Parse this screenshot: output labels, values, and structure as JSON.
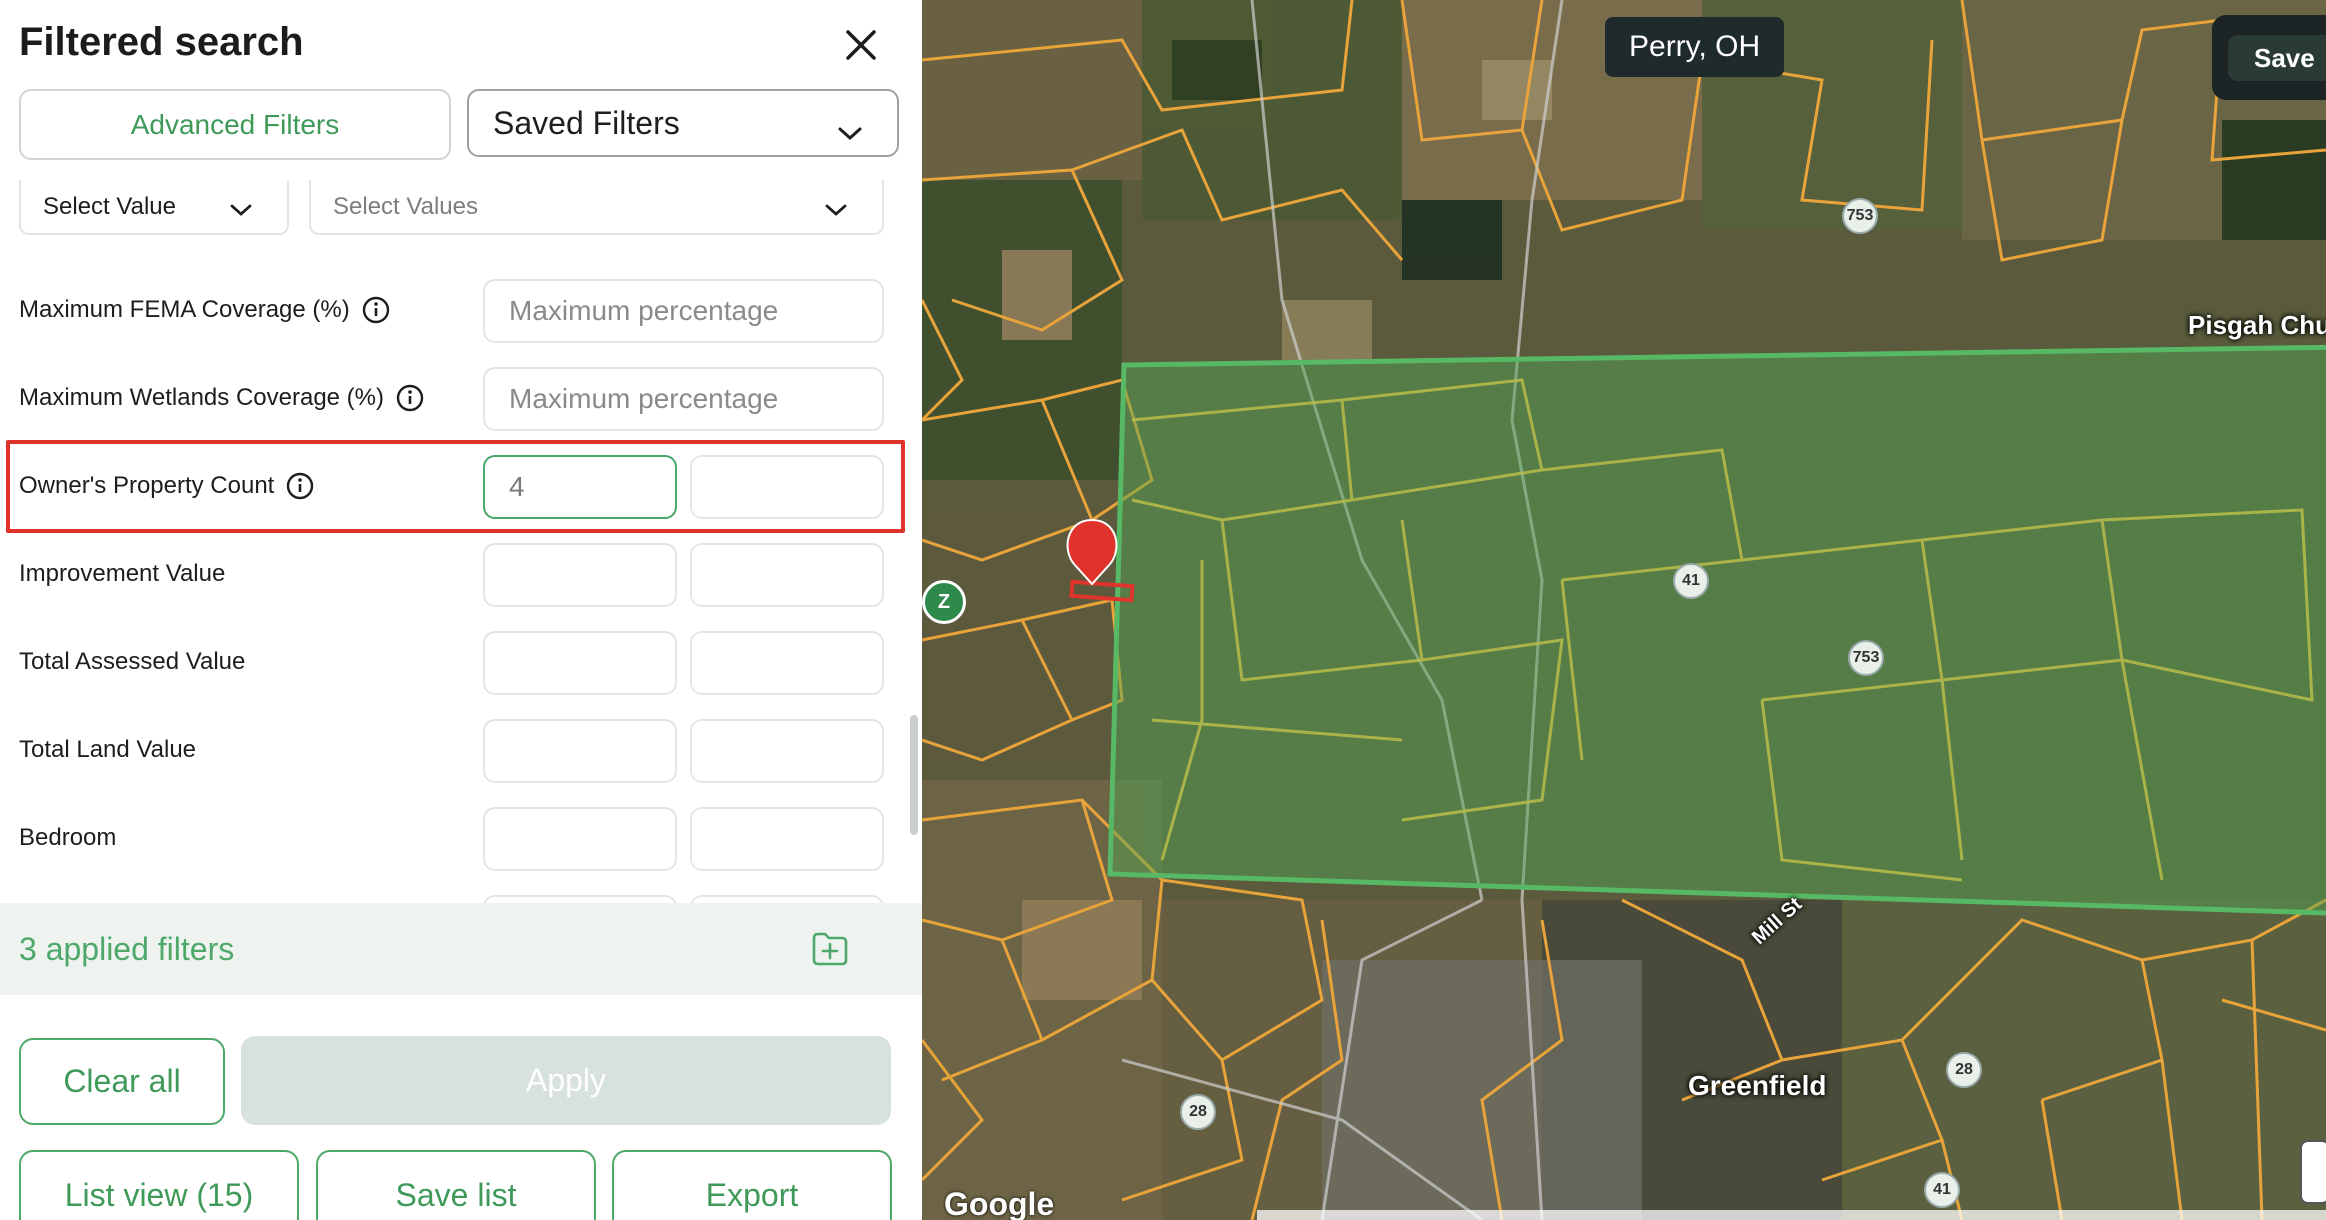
{
  "panel": {
    "title": "Filtered search",
    "tabs": {
      "advanced": "Advanced Filters",
      "saved": "Saved Filters"
    },
    "selects": {
      "value": "Select Value",
      "values_placeholder": "Select Values"
    },
    "fields": [
      {
        "label": "Maximum FEMA Coverage (%)",
        "placeholder": "Maximum percentage"
      },
      {
        "label": "Maximum Wetlands Coverage (%)",
        "placeholder": "Maximum percentage"
      },
      {
        "label": "Owner's Property Count",
        "min_value": "4",
        "max_value": ""
      },
      {
        "label": "Improvement Value"
      },
      {
        "label": "Total Assessed Value"
      },
      {
        "label": "Total Land Value"
      },
      {
        "label": "Bedroom"
      }
    ],
    "applied": "3 applied filters",
    "buttons": {
      "clear": "Clear all",
      "apply": "Apply",
      "list_view": "List view (15)",
      "save_list": "Save list",
      "export": "Export"
    }
  },
  "map": {
    "location": "Perry, OH",
    "save": "Save",
    "labels": {
      "town": "Greenfield",
      "place": "Pisgah Chu",
      "street": "Mill St"
    },
    "route_shields": [
      "753",
      "41",
      "753",
      "28",
      "28",
      "41"
    ],
    "left_marker": "Z",
    "logo": "Google"
  },
  "colors": {
    "accent": "#4ea86a",
    "highlight": "#e0332b",
    "parcel_lines": "#e8a33a",
    "selection": "#57b865"
  }
}
